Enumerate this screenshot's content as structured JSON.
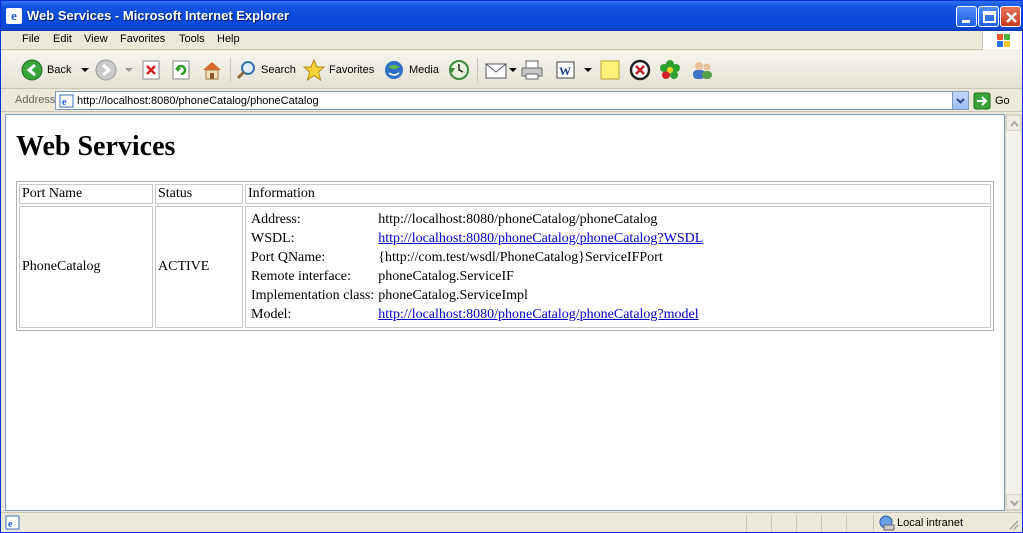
{
  "window": {
    "title": "Web Services - Microsoft Internet Explorer"
  },
  "menu": [
    "File",
    "Edit",
    "View",
    "Favorites",
    "Tools",
    "Help"
  ],
  "toolbar": {
    "back_label": "Back",
    "search_label": "Search",
    "favorites_label": "Favorites",
    "media_label": "Media"
  },
  "address": {
    "label": "Address",
    "url": "http://localhost:8080/phoneCatalog/phoneCatalog",
    "go_label": "Go"
  },
  "page": {
    "heading": "Web Services",
    "table": {
      "headers": [
        "Port Name",
        "Status",
        "Information"
      ],
      "row": {
        "port_name": "PhoneCatalog",
        "status": "ACTIVE",
        "info": [
          {
            "label": "Address:",
            "value": "http://localhost:8080/phoneCatalog/phoneCatalog",
            "link": false
          },
          {
            "label": "WSDL:",
            "value": "http://localhost:8080/phoneCatalog/phoneCatalog?WSDL",
            "link": true
          },
          {
            "label": "Port QName:",
            "value": "{http://com.test/wsdl/PhoneCatalog}ServiceIFPort",
            "link": false
          },
          {
            "label": "Remote interface:",
            "value": "phoneCatalog.ServiceIF",
            "link": false
          },
          {
            "label": "Implementation class:",
            "value": "phoneCatalog.ServiceImpl",
            "link": false
          },
          {
            "label": "Model:",
            "value": "http://localhost:8080/phoneCatalog/phoneCatalog?model",
            "link": true
          }
        ]
      }
    }
  },
  "statusbar": {
    "zone": "Local intranet"
  },
  "colors": {
    "titlebar": "#0a48d8",
    "link": "#0000cc",
    "chrome": "#ece9d8"
  }
}
